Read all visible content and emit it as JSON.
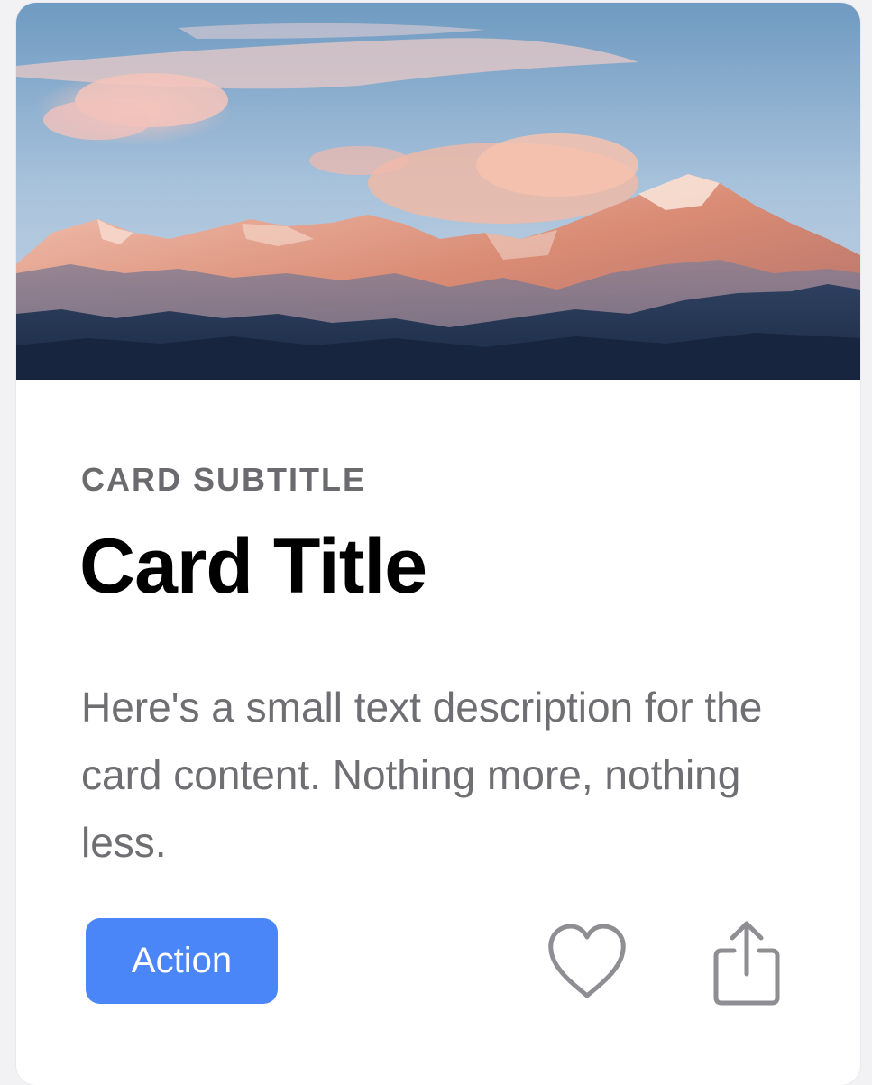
{
  "card": {
    "subtitle": "CARD SUBTITLE",
    "title": "Card Title",
    "description": "Here's a small text description for the card content. Nothing more, nothing less.",
    "action_label": "Action",
    "image_subject": "snow-capped mountain range at sunset",
    "icons": {
      "like": "heart-icon",
      "share": "share-icon"
    },
    "colors": {
      "action_button": "#4a86f7",
      "subtitle_text": "#6b6b6f",
      "description_text": "#6e6e73",
      "icon_stroke": "#8e8e93"
    }
  }
}
